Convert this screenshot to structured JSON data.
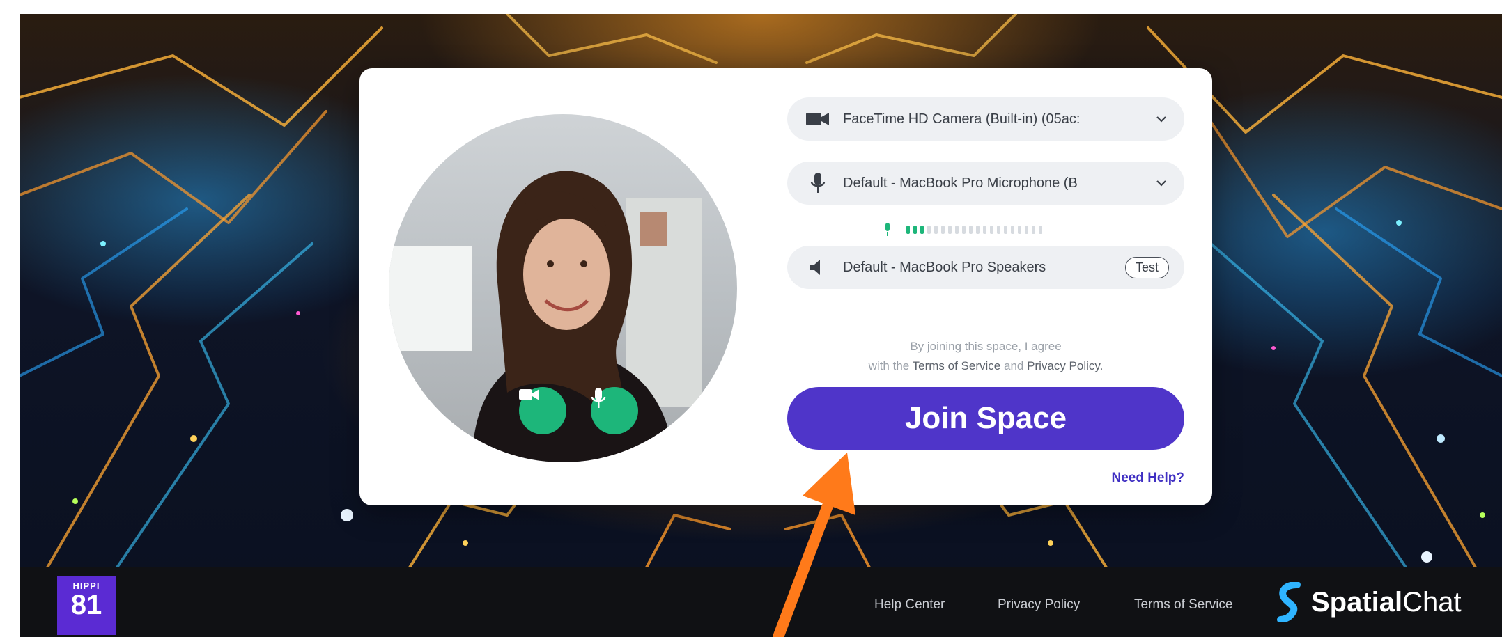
{
  "colors": {
    "join_button": "#4f35c9",
    "media_button": "#1db67a",
    "need_help": "#3f2fc2",
    "footer_bg": "#101114",
    "annotation_arrow": "#ff7a1a"
  },
  "join_card": {
    "camera_select": {
      "icon": "video-camera-icon",
      "value": "FaceTime HD Camera (Built-in) (05ac:"
    },
    "microphone_select": {
      "icon": "microphone-icon",
      "value": "Default - MacBook Pro Microphone (B"
    },
    "mic_level": {
      "active_segments": 3,
      "total_segments": 20
    },
    "speaker_select": {
      "icon": "speaker-icon",
      "value": "Default - MacBook Pro Speakers",
      "test_label": "Test"
    },
    "terms": {
      "line1": "By joining this space, I agree",
      "prefix": "with the",
      "terms_link": "Terms of Service",
      "and": "and",
      "privacy_link": "Privacy Policy."
    },
    "join_button_label": "Join Space",
    "need_help_label": "Need Help?",
    "media_buttons": {
      "camera_icon": "video-camera-icon",
      "mic_icon": "microphone-icon"
    }
  },
  "footer": {
    "brand": {
      "small_text": "HIPPI",
      "big_text": "81"
    },
    "links": [
      "Help Center",
      "Privacy Policy",
      "Terms of Service"
    ],
    "spatialchat": {
      "bold": "Spatial",
      "regular": "Chat",
      "icon": "spatialchat-logo-icon"
    }
  }
}
